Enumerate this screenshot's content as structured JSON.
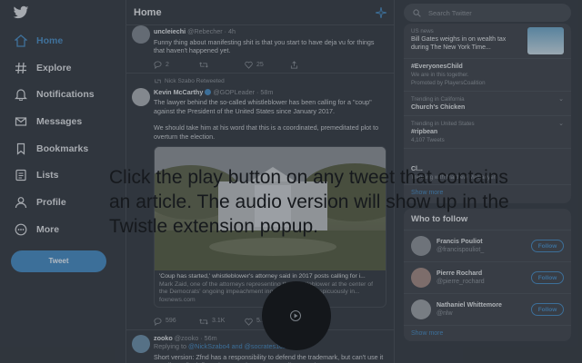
{
  "sidebar": {
    "items": [
      {
        "label": "Home",
        "icon": "home-icon"
      },
      {
        "label": "Explore",
        "icon": "hashtag-icon"
      },
      {
        "label": "Notifications",
        "icon": "bell-icon"
      },
      {
        "label": "Messages",
        "icon": "mail-icon"
      },
      {
        "label": "Bookmarks",
        "icon": "bookmark-icon"
      },
      {
        "label": "Lists",
        "icon": "list-icon"
      },
      {
        "label": "Profile",
        "icon": "person-icon"
      },
      {
        "label": "More",
        "icon": "more-icon"
      }
    ],
    "tweet_label": "Tweet"
  },
  "main": {
    "title": "Home",
    "tweets": [
      {
        "name": "uncleiechi",
        "handle": "@Rebecher · 4h",
        "text": "Funny thing about manifesting shit is that you start to have deja vu for things that haven't happened yet.",
        "replies": "2",
        "retweets": "",
        "likes": "25"
      },
      {
        "retweeted_by": "Nick Szabo Retweeted",
        "name": "Kevin McCarthy",
        "handle": "@GOPLeader · 58m",
        "text1": "The lawyer behind the so-called whistleblower has been calling for a \"coup\" against the President of the United States since January 2017.",
        "text2": "We should take him at his word that this is a coordinated, premeditated plot to overturn the election.",
        "card_title": "'Coup has started,' whistleblower's attorney said in 2017 posts calling for i...",
        "card_desc": "Mark Zaid, one of the attorneys representing the whistleblower at the center of the Democrats' ongoing impeachment inquiry, tweeted conspicuously in...",
        "card_domain": "foxnews.com",
        "replies": "596",
        "retweets": "3.1K",
        "likes": "5.1K"
      },
      {
        "name": "zooko",
        "handle": "@zooko · 56m",
        "reply_prefix": "Replying to",
        "reply_users": "@NickSzabo4 and @socrates1024",
        "text": "Short version: Zfnd has a responsibility to defend the trademark, but can't use it to unilaterally define what \"Zcash\" means. Medium version:"
      }
    ]
  },
  "right": {
    "search_placeholder": "Search Twitter",
    "trends": [
      {
        "ctx": "US news",
        "name": "Bill Gates weighs in on wealth tax during The New York Time...",
        "sub": ""
      },
      {
        "ctx": "",
        "name": "#EveryonesChild",
        "sub": "We are in this together.",
        "sub2": "Promoted by PlayersCoalition"
      },
      {
        "ctx": "Trending in California",
        "name": "Church's Chicken",
        "sub": ""
      },
      {
        "ctx": "Trending in United States",
        "name": "#ripbean",
        "sub": "4,107 Tweets"
      },
      {
        "ctx": "",
        "name": "Cl...",
        "sub": "Trending with Matthew Macfadyen"
      }
    ],
    "show_more_trends": "Show more",
    "wtf_title": "Who to follow",
    "follow": [
      {
        "name": "Francis Pouliot",
        "handle": "@francispouliot_",
        "btn": "Follow"
      },
      {
        "name": "Pierre Rochard",
        "handle": "@pierre_rochard",
        "btn": "Follow"
      },
      {
        "name": "Nathaniel Whittemore",
        "handle": "@nlw",
        "btn": "Follow"
      }
    ],
    "show_more_follow": "Show more"
  },
  "overlay": {
    "text": "Click the play button on any tweet that contains an article. The audio version will show up in the Twistle extension popup."
  },
  "colors": {
    "accent": "#4a8cc2",
    "background": "#3a4048"
  }
}
